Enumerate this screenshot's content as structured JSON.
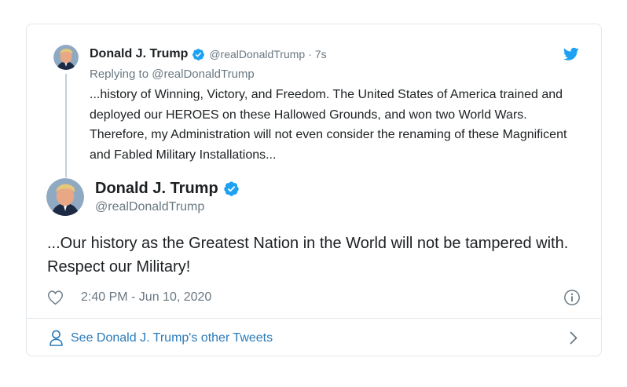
{
  "colors": {
    "link": "#2b7bb9",
    "muted": "#697882",
    "text": "#1c2022",
    "twitter_blue": "#1da1f2",
    "border": "#e1e8ed"
  },
  "parent_tweet": {
    "author_name": "Donald J. Trump",
    "handle": "@realDonaldTrump",
    "separator": "·",
    "time_ago": "7s",
    "replying_to_prefix": "Replying to",
    "replying_to_handle": "@realDonaldTrump",
    "text": "...history of Winning, Victory, and Freedom. The United States of America trained and deployed our HEROES on these Hallowed Grounds, and won two World Wars. Therefore, my Administration will not even consider the renaming of these Magnificent and Fabled Military Installations...",
    "icons": {
      "verified": "verified-badge-icon",
      "avatar": "avatar",
      "brand": "twitter-bird-icon"
    }
  },
  "main_tweet": {
    "author_name": "Donald J. Trump",
    "handle": "@realDonaldTrump",
    "text": "...Our history as the Greatest Nation in the World will not be tampered with. Respect our Military!",
    "timestamp": "2:40 PM - Jun 10, 2020",
    "icons": {
      "like": "heart-icon",
      "info": "info-icon",
      "verified": "verified-badge-icon"
    }
  },
  "footer": {
    "link_text": "See Donald J. Trump's other Tweets",
    "icons": {
      "person": "person-icon",
      "chevron": "chevron-right-icon"
    }
  }
}
